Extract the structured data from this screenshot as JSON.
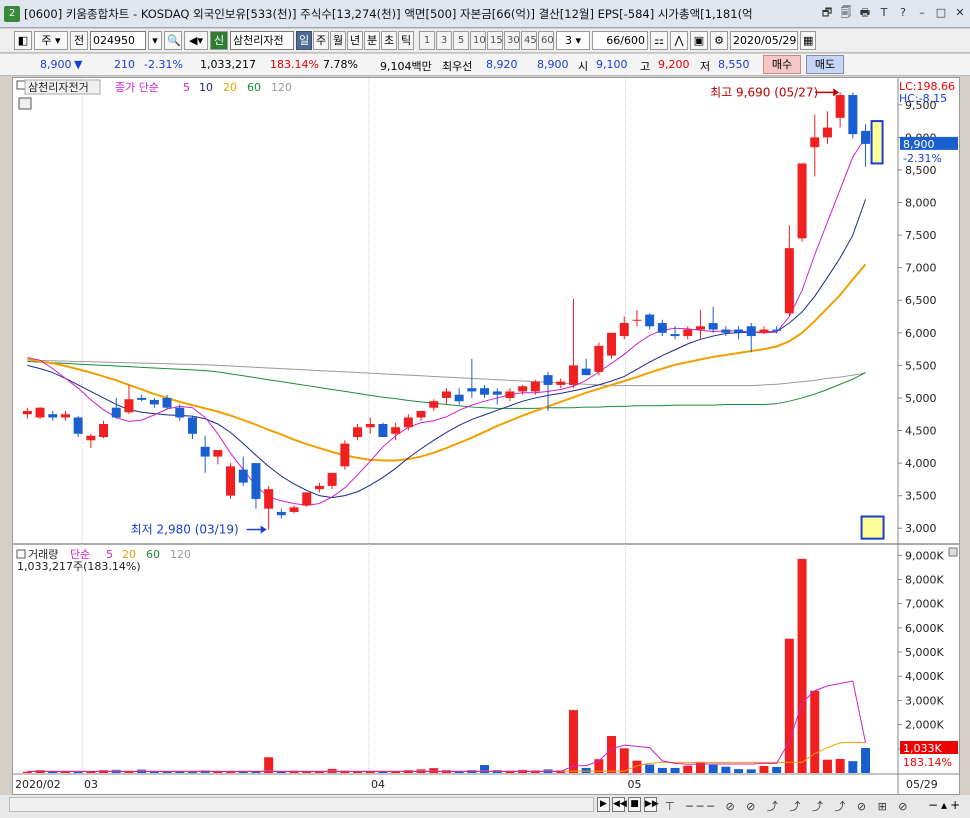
{
  "titlebar": {
    "app_number": "2",
    "title": "[0600] 키움종합차트 - KOSDAQ 외국인보유[533(천)] 주식수[13,274(천)] 액면[500] 자본금[66(억)] 결산[12월] EPS[-584] 시가총액[1,181(억",
    "buttons": [
      "🗗",
      "🗐",
      "🖶",
      "T",
      "?",
      "–",
      "□",
      "✕"
    ]
  },
  "toolbar1": {
    "type_label": "주",
    "jeon_label": "전",
    "code": "024950",
    "stock_name": "삼천리자전",
    "shin_label": "신",
    "period_buttons": [
      "일",
      "주",
      "월",
      "년",
      "분",
      "초",
      "틱"
    ],
    "minute_buttons": [
      "1",
      "3",
      "5",
      "10",
      "15",
      "30",
      "45",
      "60"
    ],
    "interval_value": "3",
    "count_value": "66",
    "count_max": "/600",
    "date_value": "2020/05/29"
  },
  "toolbar2": {
    "price": "8,900",
    "change": "210",
    "change_pct": "-2.31%",
    "volume": "1,033,217",
    "volume_pct": "183.14%",
    "turnover": "7.78%",
    "amount": "9,104백만",
    "best_bid_label": "최우선",
    "best_ask": "8,920",
    "best_bid": "8,900",
    "open_label": "시",
    "open": "9,100",
    "high_label": "고",
    "high": "9,200",
    "low_label": "저",
    "low": "8,550",
    "buy_label": "매수",
    "sell_label": "매도"
  },
  "price_panel": {
    "stock_tag": "삼천리자전거",
    "ma_label": "종가 단순",
    "ma_periods": [
      "5",
      "10",
      "20",
      "60",
      "120"
    ],
    "lc_label": "LC:198.66",
    "hc_label": "HC:-8.15",
    "current_price_label": "8,900",
    "current_change_label": "-2.31%",
    "high_annotation": "최고 9,690 (05/27)",
    "low_annotation": "최저 2,980 (03/19)",
    "y_ticks": [
      "9,500",
      "9,000",
      "8,500",
      "8,000",
      "7,500",
      "7,000",
      "6,500",
      "6,000",
      "5,500",
      "5,000",
      "4,500",
      "4,000",
      "3,500",
      "3,000"
    ]
  },
  "volume_panel": {
    "label": "거래량",
    "ma_label": "단순",
    "ma_periods": [
      "5",
      "20",
      "60",
      "120"
    ],
    "value_label": "1,033,217주(183.14%)",
    "current_label": "1,033K",
    "current_pct": "183.14%",
    "y_ticks": [
      "9,000K",
      "8,000K",
      "7,000K",
      "6,000K",
      "5,000K",
      "4,000K",
      "3,000K",
      "2,000K",
      "1,000K"
    ]
  },
  "x_axis": {
    "labels": [
      "2020/02",
      "03",
      "04",
      "05"
    ],
    "right_label": "05/29"
  },
  "colors": {
    "up": "#f02020",
    "down": "#1a5fd0",
    "ma5": "#d020d0",
    "ma10": "#1a2a8a",
    "ma20": "#f0a000",
    "ma60": "#1a8a3a",
    "ma120": "#9a9a9a"
  },
  "chart_data": {
    "type": "candlestick",
    "ylim_price": [
      2850,
      9850
    ],
    "ylim_volume": [
      0,
      9300
    ],
    "candles": [
      {
        "o": 4750,
        "h": 4850,
        "l": 4680,
        "c": 4800
      },
      {
        "o": 4700,
        "h": 4860,
        "l": 4680,
        "c": 4850
      },
      {
        "o": 4750,
        "h": 4800,
        "l": 4650,
        "c": 4700
      },
      {
        "o": 4700,
        "h": 4800,
        "l": 4650,
        "c": 4750
      },
      {
        "o": 4700,
        "h": 4720,
        "l": 4400,
        "c": 4450
      },
      {
        "o": 4350,
        "h": 4450,
        "l": 4230,
        "c": 4420
      },
      {
        "o": 4400,
        "h": 4650,
        "l": 4380,
        "c": 4600
      },
      {
        "o": 4850,
        "h": 5000,
        "l": 4680,
        "c": 4700
      },
      {
        "o": 4780,
        "h": 5200,
        "l": 4750,
        "c": 4980
      },
      {
        "o": 5000,
        "h": 5050,
        "l": 4950,
        "c": 4970
      },
      {
        "o": 4970,
        "h": 5000,
        "l": 4850,
        "c": 4900
      },
      {
        "o": 5000,
        "h": 5050,
        "l": 4820,
        "c": 4850
      },
      {
        "o": 4850,
        "h": 4900,
        "l": 4650,
        "c": 4700
      },
      {
        "o": 4700,
        "h": 4720,
        "l": 4370,
        "c": 4450
      },
      {
        "o": 4250,
        "h": 4420,
        "l": 3850,
        "c": 4100
      },
      {
        "o": 4100,
        "h": 4200,
        "l": 3980,
        "c": 4200
      },
      {
        "o": 3500,
        "h": 4000,
        "l": 3450,
        "c": 3950
      },
      {
        "o": 3900,
        "h": 4100,
        "l": 3650,
        "c": 3700
      },
      {
        "o": 4000,
        "h": 4000,
        "l": 3300,
        "c": 3450
      },
      {
        "o": 3300,
        "h": 3650,
        "l": 2980,
        "c": 3600
      },
      {
        "o": 3250,
        "h": 3300,
        "l": 3150,
        "c": 3200
      },
      {
        "o": 3250,
        "h": 3350,
        "l": 3230,
        "c": 3320
      },
      {
        "o": 3350,
        "h": 3550,
        "l": 3330,
        "c": 3550
      },
      {
        "o": 3600,
        "h": 3700,
        "l": 3550,
        "c": 3650
      },
      {
        "o": 3650,
        "h": 3850,
        "l": 3600,
        "c": 3850
      },
      {
        "o": 3950,
        "h": 4350,
        "l": 3900,
        "c": 4300
      },
      {
        "o": 4400,
        "h": 4600,
        "l": 4350,
        "c": 4550
      },
      {
        "o": 4550,
        "h": 4700,
        "l": 4450,
        "c": 4600
      },
      {
        "o": 4600,
        "h": 4620,
        "l": 4400,
        "c": 4400
      },
      {
        "o": 4450,
        "h": 4620,
        "l": 4350,
        "c": 4550
      },
      {
        "o": 4550,
        "h": 4750,
        "l": 4500,
        "c": 4700
      },
      {
        "o": 4700,
        "h": 4800,
        "l": 4650,
        "c": 4800
      },
      {
        "o": 4850,
        "h": 4980,
        "l": 4800,
        "c": 4950
      },
      {
        "o": 5000,
        "h": 5150,
        "l": 4900,
        "c": 5100
      },
      {
        "o": 5050,
        "h": 5150,
        "l": 4900,
        "c": 4950
      },
      {
        "o": 5150,
        "h": 5600,
        "l": 5000,
        "c": 5100
      },
      {
        "o": 5150,
        "h": 5200,
        "l": 5000,
        "c": 5050
      },
      {
        "o": 5100,
        "h": 5150,
        "l": 4900,
        "c": 5050
      },
      {
        "o": 5000,
        "h": 5150,
        "l": 4950,
        "c": 5100
      },
      {
        "o": 5100,
        "h": 5200,
        "l": 5050,
        "c": 5180
      },
      {
        "o": 5100,
        "h": 5280,
        "l": 5050,
        "c": 5250
      },
      {
        "o": 5350,
        "h": 5400,
        "l": 4800,
        "c": 5200
      },
      {
        "o": 5200,
        "h": 5300,
        "l": 5150,
        "c": 5250
      },
      {
        "o": 5200,
        "h": 6520,
        "l": 5150,
        "c": 5500
      },
      {
        "o": 5450,
        "h": 5600,
        "l": 5350,
        "c": 5350
      },
      {
        "o": 5400,
        "h": 5850,
        "l": 5350,
        "c": 5800
      },
      {
        "o": 5650,
        "h": 6000,
        "l": 5600,
        "c": 6000
      },
      {
        "o": 5950,
        "h": 6250,
        "l": 5900,
        "c": 6150
      },
      {
        "o": 6200,
        "h": 6350,
        "l": 6100,
        "c": 6200
      },
      {
        "o": 6280,
        "h": 6300,
        "l": 6050,
        "c": 6100
      },
      {
        "o": 6150,
        "h": 6200,
        "l": 5950,
        "c": 6000
      },
      {
        "o": 5980,
        "h": 6100,
        "l": 5900,
        "c": 5950
      },
      {
        "o": 5950,
        "h": 6100,
        "l": 5900,
        "c": 6050
      },
      {
        "o": 6050,
        "h": 6350,
        "l": 5900,
        "c": 6100
      },
      {
        "o": 6150,
        "h": 6400,
        "l": 6000,
        "c": 6050
      },
      {
        "o": 6050,
        "h": 6100,
        "l": 5950,
        "c": 6000
      },
      {
        "o": 6050,
        "h": 6100,
        "l": 5900,
        "c": 6000
      },
      {
        "o": 6100,
        "h": 6150,
        "l": 5700,
        "c": 5950
      },
      {
        "o": 6000,
        "h": 6100,
        "l": 5980,
        "c": 6050
      },
      {
        "o": 6050,
        "h": 6100,
        "l": 5990,
        "c": 6030
      },
      {
        "o": 6300,
        "h": 7650,
        "l": 6250,
        "c": 7300
      },
      {
        "o": 7450,
        "h": 8600,
        "l": 7400,
        "c": 8600
      },
      {
        "o": 8850,
        "h": 9350,
        "l": 8400,
        "c": 9000
      },
      {
        "o": 9000,
        "h": 9400,
        "l": 8900,
        "c": 9150
      },
      {
        "o": 9300,
        "h": 9690,
        "l": 9150,
        "c": 9650
      },
      {
        "o": 9650,
        "h": 9690,
        "l": 8980,
        "c": 9050
      },
      {
        "o": 9100,
        "h": 9200,
        "l": 8550,
        "c": 8900
      }
    ],
    "volume": [
      50,
      120,
      60,
      60,
      40,
      80,
      120,
      130,
      90,
      140,
      50,
      70,
      60,
      40,
      110,
      60,
      40,
      80,
      90,
      650,
      80,
      100,
      60,
      60,
      170,
      100,
      80,
      90,
      60,
      70,
      120,
      150,
      200,
      120,
      90,
      120,
      330,
      120,
      100,
      130,
      110,
      150,
      110,
      2600,
      210,
      570,
      1530,
      1020,
      510,
      350,
      210,
      210,
      300,
      460,
      340,
      260,
      160,
      150,
      290,
      250,
      5550,
      8850,
      3400,
      550,
      580,
      490,
      1033
    ],
    "ma5": [
      5620,
      5580,
      5450,
      5300,
      5150,
      4970,
      4820,
      4700,
      4640,
      4660,
      4740,
      4830,
      4870,
      4850,
      4700,
      4450,
      4150,
      3900,
      3650,
      3480,
      3420,
      3380,
      3350,
      3380,
      3480,
      3620,
      3820,
      4030,
      4250,
      4420,
      4550,
      4620,
      4650,
      4710,
      4810,
      4890,
      4950,
      5000,
      5050,
      5080,
      5080,
      5100,
      5130,
      5180,
      5270,
      5400,
      5530,
      5670,
      5830,
      5960,
      6040,
      6070,
      6060,
      6040,
      6020,
      6030,
      6030,
      6010,
      6000,
      6010,
      6250,
      6650,
      7200,
      7700,
      8200,
      8700,
      9000
    ],
    "ma10": [
      5500,
      5450,
      5390,
      5300,
      5200,
      5100,
      5000,
      4900,
      4820,
      4780,
      4760,
      4740,
      4730,
      4720,
      4680,
      4600,
      4470,
      4300,
      4120,
      3950,
      3800,
      3680,
      3580,
      3500,
      3470,
      3500,
      3560,
      3660,
      3780,
      3920,
      4080,
      4220,
      4350,
      4470,
      4580,
      4670,
      4740,
      4810,
      4880,
      4950,
      5000,
      5040,
      5070,
      5110,
      5150,
      5200,
      5260,
      5330,
      5440,
      5550,
      5650,
      5740,
      5830,
      5900,
      5950,
      5990,
      6000,
      6010,
      6010,
      6020,
      6150,
      6320,
      6560,
      6850,
      7150,
      7500,
      8050
    ],
    "ma20": [
      5600,
      5560,
      5530,
      5490,
      5440,
      5390,
      5330,
      5270,
      5200,
      5130,
      5060,
      5000,
      4940,
      4890,
      4840,
      4790,
      4730,
      4660,
      4590,
      4510,
      4440,
      4360,
      4290,
      4230,
      4170,
      4120,
      4080,
      4050,
      4040,
      4040,
      4060,
      4100,
      4160,
      4230,
      4310,
      4390,
      4480,
      4570,
      4650,
      4730,
      4800,
      4870,
      4940,
      5010,
      5080,
      5140,
      5200,
      5260,
      5320,
      5390,
      5450,
      5510,
      5550,
      5590,
      5630,
      5660,
      5690,
      5720,
      5750,
      5790,
      5870,
      6000,
      6180,
      6380,
      6580,
      6820,
      7050
    ],
    "ma60": [
      5560,
      5550,
      5540,
      5530,
      5520,
      5510,
      5500,
      5490,
      5480,
      5470,
      5460,
      5450,
      5440,
      5430,
      5420,
      5400,
      5370,
      5340,
      5310,
      5280,
      5250,
      5220,
      5190,
      5160,
      5130,
      5100,
      5070,
      5040,
      5010,
      4990,
      4960,
      4940,
      4920,
      4900,
      4880,
      4860,
      4850,
      4840,
      4840,
      4840,
      4840,
      4850,
      4850,
      4850,
      4860,
      4860,
      4870,
      4870,
      4880,
      4880,
      4880,
      4890,
      4890,
      4890,
      4890,
      4900,
      4900,
      4900,
      4900,
      4910,
      4950,
      5000,
      5060,
      5130,
      5210,
      5290,
      5390
    ],
    "ma120": [
      5580,
      5575,
      5570,
      5565,
      5560,
      5555,
      5550,
      5545,
      5540,
      5535,
      5530,
      5525,
      5520,
      5515,
      5510,
      5500,
      5490,
      5480,
      5470,
      5460,
      5450,
      5440,
      5430,
      5420,
      5410,
      5400,
      5390,
      5380,
      5370,
      5360,
      5350,
      5340,
      5330,
      5320,
      5310,
      5300,
      5290,
      5280,
      5270,
      5260,
      5250,
      5240,
      5230,
      5220,
      5210,
      5200,
      5190,
      5190,
      5190,
      5190,
      5190,
      5190,
      5190,
      5190,
      5190,
      5190,
      5190,
      5190,
      5200,
      5210,
      5230,
      5250,
      5270,
      5300,
      5320,
      5350,
      5380
    ],
    "volma5": [
      60,
      60,
      60,
      60,
      60,
      60,
      60,
      60,
      60,
      60,
      60,
      60,
      60,
      60,
      60,
      60,
      60,
      60,
      60,
      60,
      60,
      60,
      60,
      60,
      60,
      60,
      60,
      60,
      60,
      60,
      60,
      60,
      60,
      60,
      60,
      60,
      60,
      60,
      60,
      60,
      60,
      60,
      60,
      300,
      300,
      500,
      1000,
      1150,
      1100,
      1050,
      500,
      400,
      360,
      370,
      370,
      370,
      370,
      370,
      400,
      400,
      1300,
      2900,
      3400,
      3600,
      3700,
      3800,
      1250
    ],
    "volma20": [
      80,
      80,
      80,
      80,
      80,
      80,
      80,
      80,
      80,
      80,
      80,
      80,
      80,
      80,
      80,
      80,
      80,
      80,
      80,
      80,
      80,
      80,
      80,
      80,
      80,
      80,
      80,
      80,
      80,
      80,
      80,
      80,
      80,
      80,
      80,
      80,
      80,
      80,
      80,
      80,
      80,
      80,
      80,
      80,
      80,
      80,
      80,
      80,
      300,
      400,
      440,
      440,
      440,
      440,
      440,
      440,
      440,
      440,
      440,
      440,
      440,
      440,
      800,
      1050,
      1250,
      1270,
      1250
    ]
  }
}
